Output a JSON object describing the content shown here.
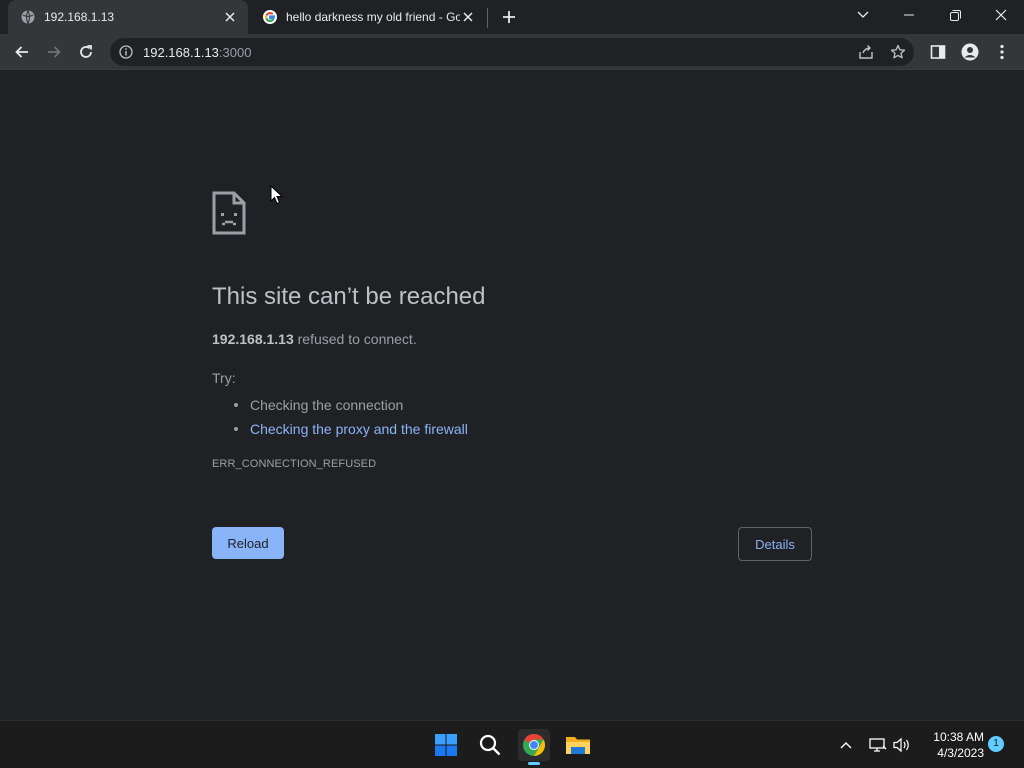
{
  "browser": {
    "tabs": [
      {
        "title": "192.168.1.13",
        "active": true,
        "icon": "globe-icon"
      },
      {
        "title": "hello darkness my old friend - Go",
        "active": false,
        "icon": "google-icon"
      }
    ],
    "window_controls": [
      "chevron-down-icon",
      "minimize-icon",
      "restore-icon",
      "close-icon"
    ],
    "address_bar": {
      "host": "192.168.1.13",
      "port": ":3000"
    }
  },
  "error_page": {
    "title": "This site can’t be reached",
    "host": "192.168.1.13",
    "description": " refused to connect.",
    "try_label": "Try:",
    "suggestions": [
      {
        "text": "Checking the connection",
        "link": false
      },
      {
        "text": "Checking the proxy and the firewall",
        "link": true
      }
    ],
    "error_code": "ERR_CONNECTION_REFUSED",
    "reload_label": "Reload",
    "details_label": "Details"
  },
  "taskbar": {
    "apps": [
      "windows-start-icon",
      "search-icon",
      "chrome-icon",
      "file-explorer-icon"
    ],
    "time": "10:38 AM",
    "date": "4/3/2023",
    "notification_count": "1"
  },
  "colors": {
    "background": "#202124",
    "toolbar": "#35363a",
    "accent": "#8ab4f8",
    "taskbar": "#1c1c1c"
  }
}
